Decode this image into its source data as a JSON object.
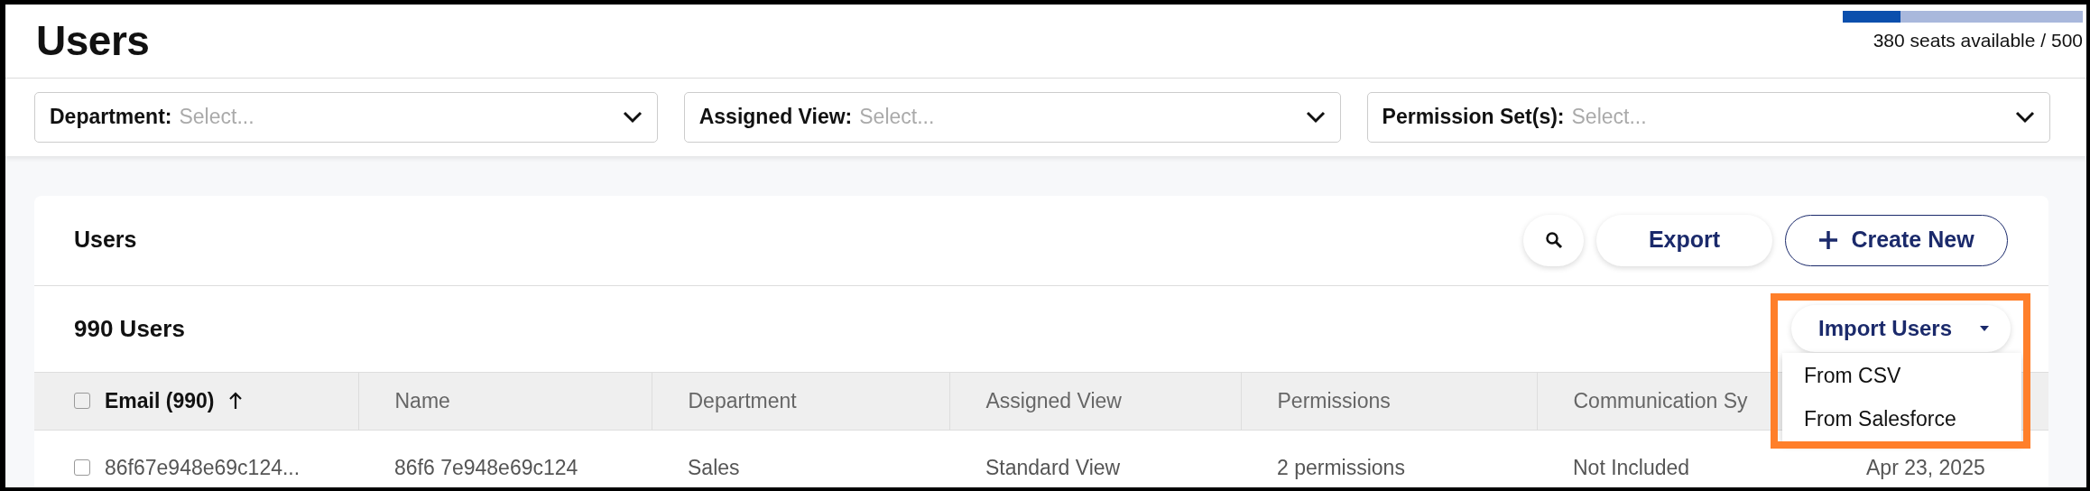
{
  "page": {
    "title": "Users",
    "seats": {
      "level": 0.24,
      "label": "380 seats available / 500"
    }
  },
  "filters": [
    {
      "label": "Department:",
      "placeholder": "Select..."
    },
    {
      "label": "Assigned View:",
      "placeholder": "Select..."
    },
    {
      "label": "Permission Set(s):",
      "placeholder": "Select..."
    }
  ],
  "card": {
    "title": "Users",
    "actions": [
      {
        "kind": "search"
      },
      {
        "kind": "plain",
        "label": "Export"
      },
      {
        "kind": "create",
        "label": "Create New"
      }
    ],
    "count": "990 Users",
    "import": {
      "label": "Import Users",
      "expanded": true,
      "highlighted": true,
      "items": [
        "From CSV",
        "From Salesforce"
      ]
    },
    "table": {
      "columns": [
        {
          "label": "Email (990)",
          "sorted": true
        },
        {
          "label": "Name",
          "sorted": false
        },
        {
          "label": "Department",
          "sorted": false
        },
        {
          "label": "Assigned View",
          "sorted": false
        },
        {
          "label": "Permissions",
          "sorted": false
        },
        {
          "label": "Communication Sy",
          "sorted": false
        }
      ],
      "header_checked": false,
      "rows": [
        {
          "checked": false,
          "cells": [
            "86f67e948e69c124...",
            "86f6 7e948e69c124",
            "Sales",
            "Standard View",
            "2 permissions",
            "Not Included",
            "Apr 23, 2025"
          ]
        }
      ]
    }
  }
}
